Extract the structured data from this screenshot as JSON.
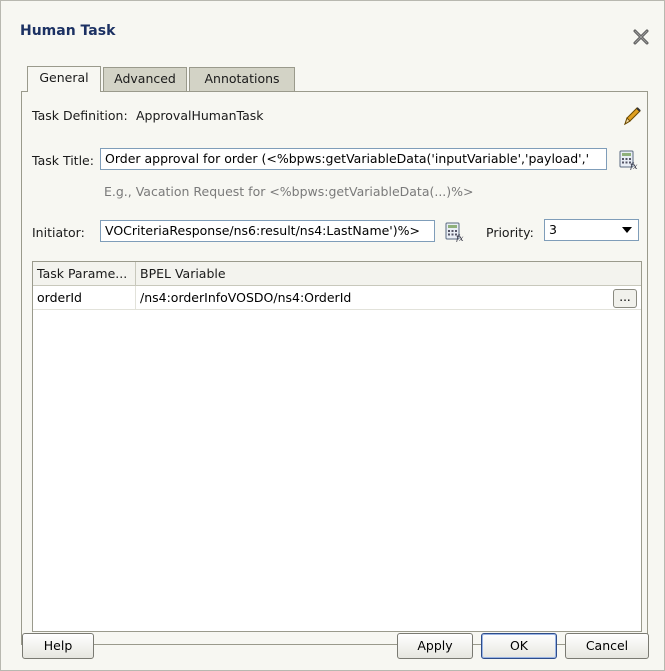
{
  "dialog": {
    "title": "Human Task"
  },
  "tabs": [
    {
      "label": "General",
      "active": true
    },
    {
      "label": "Advanced",
      "active": false
    },
    {
      "label": "Annotations",
      "active": false
    }
  ],
  "general": {
    "task_definition_label": "Task Definition:",
    "task_definition_value": "ApprovalHumanTask",
    "task_title_label": "Task Title:",
    "task_title_value": "Order approval for order (<%bpws:getVariableData('inputVariable','payload','",
    "task_title_hint": "E.g., Vacation Request for <%bpws:getVariableData(...)%>",
    "initiator_label": "Initiator:",
    "initiator_value": "VOCriteriaResponse/ns6:result/ns4:LastName')%>",
    "priority_label": "Priority:",
    "priority_value": "3"
  },
  "table": {
    "columns": [
      "Task Parame...",
      "BPEL Variable"
    ],
    "rows": [
      {
        "param": "orderId",
        "variable": "/ns4:orderInfoVOSDO/ns4:OrderId",
        "button": "..."
      }
    ]
  },
  "buttons": {
    "help": "Help",
    "apply": "Apply",
    "ok": "OK",
    "cancel": "Cancel"
  },
  "icons": {
    "close": "close-icon",
    "edit": "pencil-icon",
    "expression_builder": "expression-builder-icon"
  }
}
